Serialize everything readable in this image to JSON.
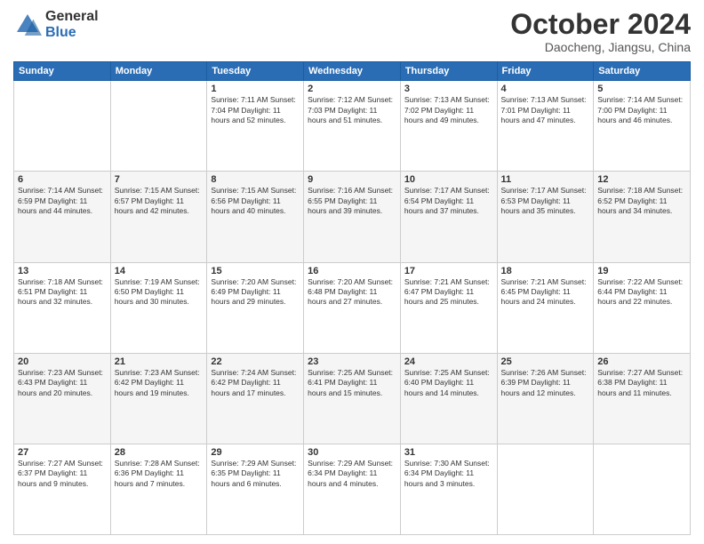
{
  "logo": {
    "general": "General",
    "blue": "Blue"
  },
  "title": "October 2024",
  "location": "Daocheng, Jiangsu, China",
  "days": [
    "Sunday",
    "Monday",
    "Tuesday",
    "Wednesday",
    "Thursday",
    "Friday",
    "Saturday"
  ],
  "weeks": [
    [
      {
        "day": null,
        "text": null
      },
      {
        "day": null,
        "text": null
      },
      {
        "day": "1",
        "text": "Sunrise: 7:11 AM\nSunset: 7:04 PM\nDaylight: 11 hours and 52 minutes."
      },
      {
        "day": "2",
        "text": "Sunrise: 7:12 AM\nSunset: 7:03 PM\nDaylight: 11 hours and 51 minutes."
      },
      {
        "day": "3",
        "text": "Sunrise: 7:13 AM\nSunset: 7:02 PM\nDaylight: 11 hours and 49 minutes."
      },
      {
        "day": "4",
        "text": "Sunrise: 7:13 AM\nSunset: 7:01 PM\nDaylight: 11 hours and 47 minutes."
      },
      {
        "day": "5",
        "text": "Sunrise: 7:14 AM\nSunset: 7:00 PM\nDaylight: 11 hours and 46 minutes."
      }
    ],
    [
      {
        "day": "6",
        "text": "Sunrise: 7:14 AM\nSunset: 6:59 PM\nDaylight: 11 hours and 44 minutes."
      },
      {
        "day": "7",
        "text": "Sunrise: 7:15 AM\nSunset: 6:57 PM\nDaylight: 11 hours and 42 minutes."
      },
      {
        "day": "8",
        "text": "Sunrise: 7:15 AM\nSunset: 6:56 PM\nDaylight: 11 hours and 40 minutes."
      },
      {
        "day": "9",
        "text": "Sunrise: 7:16 AM\nSunset: 6:55 PM\nDaylight: 11 hours and 39 minutes."
      },
      {
        "day": "10",
        "text": "Sunrise: 7:17 AM\nSunset: 6:54 PM\nDaylight: 11 hours and 37 minutes."
      },
      {
        "day": "11",
        "text": "Sunrise: 7:17 AM\nSunset: 6:53 PM\nDaylight: 11 hours and 35 minutes."
      },
      {
        "day": "12",
        "text": "Sunrise: 7:18 AM\nSunset: 6:52 PM\nDaylight: 11 hours and 34 minutes."
      }
    ],
    [
      {
        "day": "13",
        "text": "Sunrise: 7:18 AM\nSunset: 6:51 PM\nDaylight: 11 hours and 32 minutes."
      },
      {
        "day": "14",
        "text": "Sunrise: 7:19 AM\nSunset: 6:50 PM\nDaylight: 11 hours and 30 minutes."
      },
      {
        "day": "15",
        "text": "Sunrise: 7:20 AM\nSunset: 6:49 PM\nDaylight: 11 hours and 29 minutes."
      },
      {
        "day": "16",
        "text": "Sunrise: 7:20 AM\nSunset: 6:48 PM\nDaylight: 11 hours and 27 minutes."
      },
      {
        "day": "17",
        "text": "Sunrise: 7:21 AM\nSunset: 6:47 PM\nDaylight: 11 hours and 25 minutes."
      },
      {
        "day": "18",
        "text": "Sunrise: 7:21 AM\nSunset: 6:45 PM\nDaylight: 11 hours and 24 minutes."
      },
      {
        "day": "19",
        "text": "Sunrise: 7:22 AM\nSunset: 6:44 PM\nDaylight: 11 hours and 22 minutes."
      }
    ],
    [
      {
        "day": "20",
        "text": "Sunrise: 7:23 AM\nSunset: 6:43 PM\nDaylight: 11 hours and 20 minutes."
      },
      {
        "day": "21",
        "text": "Sunrise: 7:23 AM\nSunset: 6:42 PM\nDaylight: 11 hours and 19 minutes."
      },
      {
        "day": "22",
        "text": "Sunrise: 7:24 AM\nSunset: 6:42 PM\nDaylight: 11 hours and 17 minutes."
      },
      {
        "day": "23",
        "text": "Sunrise: 7:25 AM\nSunset: 6:41 PM\nDaylight: 11 hours and 15 minutes."
      },
      {
        "day": "24",
        "text": "Sunrise: 7:25 AM\nSunset: 6:40 PM\nDaylight: 11 hours and 14 minutes."
      },
      {
        "day": "25",
        "text": "Sunrise: 7:26 AM\nSunset: 6:39 PM\nDaylight: 11 hours and 12 minutes."
      },
      {
        "day": "26",
        "text": "Sunrise: 7:27 AM\nSunset: 6:38 PM\nDaylight: 11 hours and 11 minutes."
      }
    ],
    [
      {
        "day": "27",
        "text": "Sunrise: 7:27 AM\nSunset: 6:37 PM\nDaylight: 11 hours and 9 minutes."
      },
      {
        "day": "28",
        "text": "Sunrise: 7:28 AM\nSunset: 6:36 PM\nDaylight: 11 hours and 7 minutes."
      },
      {
        "day": "29",
        "text": "Sunrise: 7:29 AM\nSunset: 6:35 PM\nDaylight: 11 hours and 6 minutes."
      },
      {
        "day": "30",
        "text": "Sunrise: 7:29 AM\nSunset: 6:34 PM\nDaylight: 11 hours and 4 minutes."
      },
      {
        "day": "31",
        "text": "Sunrise: 7:30 AM\nSunset: 6:34 PM\nDaylight: 11 hours and 3 minutes."
      },
      {
        "day": null,
        "text": null
      },
      {
        "day": null,
        "text": null
      }
    ]
  ]
}
